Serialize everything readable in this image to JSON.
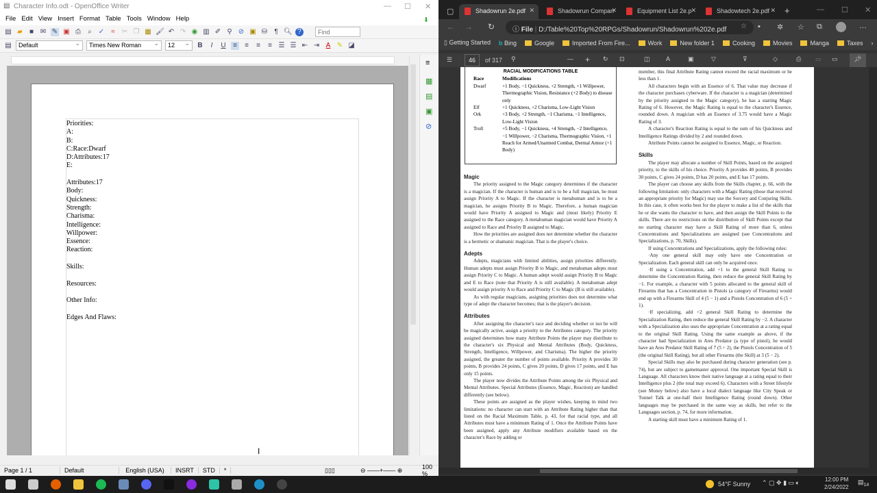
{
  "writer": {
    "title": "Character Info.odt - OpenOffice Writer",
    "menu": [
      "File",
      "Edit",
      "View",
      "Insert",
      "Format",
      "Table",
      "Tools",
      "Window",
      "Help"
    ],
    "find_placeholder": "Find",
    "paragraph_style": "Default",
    "font_name": "Times New Roman",
    "font_size": "12",
    "document_lines": [
      "Priorities:",
      "A:",
      "B:",
      "C:Race:Dwarf",
      "D:Attributes:17",
      "E:",
      "",
      "Attributes:17",
      "Body:",
      "Quickness:",
      "Strength:",
      "Charisma:",
      "Intelligence:",
      "Willpower:",
      "Essence:",
      "Reaction:",
      "",
      "Skills:",
      "",
      "Resources:",
      "",
      "Other Info:",
      "",
      "Edges And Flaws:"
    ],
    "status": {
      "page": "Page 1 / 1",
      "style": "Default",
      "language": "English (USA)",
      "insert_mode": "INSRT",
      "selection_mode": "STD",
      "modified": "*",
      "zoom": "100 %"
    }
  },
  "browser": {
    "tabs": [
      {
        "label": "Shadowrun 2e.pdf",
        "active": true
      },
      {
        "label": "Shadowrun Compan",
        "active": false
      },
      {
        "label": "Equipment List 2e.p",
        "active": false
      },
      {
        "label": "Shadowtech 2e.pdf",
        "active": false
      }
    ],
    "address_prefix": "File",
    "address": "D:/Table%20Top%20RPGs/Shadowrun/Shadowrun%202e.pdf",
    "bookmarks": [
      {
        "label": "Getting Started",
        "icon": "page-icon"
      },
      {
        "label": "Bing",
        "icon": "bing-icon"
      },
      {
        "label": "Google",
        "icon": "folder-icon"
      },
      {
        "label": "Imported From Fire...",
        "icon": "folder-icon"
      },
      {
        "label": "Work",
        "icon": "folder-icon"
      },
      {
        "label": "New folder 1",
        "icon": "folder-icon"
      },
      {
        "label": "Cooking",
        "icon": "folder-icon"
      },
      {
        "label": "Movies",
        "icon": "folder-icon"
      },
      {
        "label": "Manga",
        "icon": "folder-icon"
      },
      {
        "label": "Taxes",
        "icon": "folder-icon"
      }
    ],
    "pdf": {
      "page": "46",
      "of_pages": "of 317"
    }
  },
  "pdf_content": {
    "table": {
      "title": "RACIAL MODIFICATIONS TABLE",
      "headers": [
        "Race",
        "Modifications"
      ],
      "rows": [
        [
          "Dwarf",
          "+1 Body, −1 Quickness, +2 Strength, +1 Willpower, Thermographic Vision, Resistance (+2 Body) to disease only"
        ],
        [
          "Elf",
          "+1 Quickness, +2 Charisma, Low-Light Vision"
        ],
        [
          "Ork",
          "+3 Body, +2 Strength, −1 Charisma, −1 Intelligence, Low-Light Vision"
        ],
        [
          "Troll",
          "+5 Body, −1 Quickness, +4 Strength, −2 Intelligence, −1 Willpower, −2 Charisma, Thermographic Vision, +1 Reach for Armed/Unarmed Combat, Dermal Armor (+1 Body)"
        ]
      ]
    },
    "left": [
      {
        "h": "Magic"
      },
      {
        "p": "The priority assigned to the Magic category determines if the character is a magician. If the character is human and is to be a full magician, he must assign Priority A to Magic. If the character is metahuman and is to be a magician, he assigns Priority B to Magic. Therefore, a human magician would have Priority A assigned to Magic and (most likely) Priority E assigned to the Race category. A metahuman magician would have Priority A assigned to Race and Priority B assigned to Magic."
      },
      {
        "p": "How the priorities are assigned does not determine whether the character is a hermetic or shamanic magician. That is the player's choice."
      },
      {
        "h": "Adepts"
      },
      {
        "p": "Adepts, magicians with limited abilities, assign priorities differently. Human adepts must assign Priority B to Magic, and metahuman adepts must assign Priority C to Magic. A human adept would assign Priority B to Magic and E to Race (note that Priority A is still available). A metahuman adept would assign priority A to Race and Priority C to Magic (B is still available)."
      },
      {
        "p": "As with regular magicians, assigning priorities does not determine what type of adept the character becomes; that is the player's decision."
      },
      {
        "h": "Attributes"
      },
      {
        "p": "After assigning the character's race and deciding whether or not he will be magically active, assign a priority to the Attributes category. The priority assigned determines how many Attribute Points the player may distribute to the character's six Physical and Mental Attributes (Body, Quickness, Strength, Intelligence, Willpower, and Charisma). The higher the priority assigned, the greater the number of points available. Priority A provides 30 points, B provides 24 points, C gives 20 points, D gives 17 points, and E has only 15 points."
      },
      {
        "p": "The player now divides the Attribute Points among the six Physical and Mental Attributes. Special Attributes (Essence, Magic, Reaction) are handled differently (see below)."
      },
      {
        "p": "These points are assigned as the player wishes, keeping in mind two limitations: no character can start with an Attribute Rating higher than that listed on the Racial Maximum Table, p. 43, for that racial type, and all Attributes must have a minimum Rating of 1. Once the Attribute Points have been assigned, apply any Attribute modifiers available based on the character's Race by adding or"
      }
    ],
    "right": [
      {
        "p0": "member, this final Attribute Rating cannot exceed the racial maximum or be less than 1."
      },
      {
        "p": "All characters begin with an Essence of 6. That value may decrease if the character purchases cyberware. If the character is a magician (determined by the priority assigned to the Magic category), he has a starting Magic Rating of 6. However, the Magic Rating is equal to the character's Essence, rounded down. A magician with an Essence of 3.75 would have a Magic Rating of 3."
      },
      {
        "p": "A character's Reaction Rating is equal to the sum of his Quickness and Intelligence Ratings divided by 2 and rounded down."
      },
      {
        "p": "Attribute Points cannot be assigned to Essence, Magic, or Reaction."
      },
      {
        "h": "Skills"
      },
      {
        "p": "The player may allocate a number of Skill Points, based on the assigned priority, to the skills of his choice. Priority A provides 40 points, B provides 30 points, C gives 24 points, D has 20 points, and E has 17 points."
      },
      {
        "p": "The player can choose any skills from the Skills chapter, p. 66, with the following limitation: only characters with a Magic Rating (those that received an appropriate priority for Magic) may use the Sorcery and Conjuring Skills. In this case, it often works best for the player to make a list of the skills that he or she wants the character to have, and then assign the Skill Points to the skills. There are no restrictions on the distribution of Skill Points except that no starting character may have a Skill Rating of more than 6, unless Concentrations and Specializations are assigned (see Concentrations and Specializations, p. 70, Skills)."
      },
      {
        "p": "If using Concentrations and Specializations, apply the following rules:"
      },
      {
        "p": "·Any one general skill may only have one Concentration or Specialization. Each general skill can only be acquired once."
      },
      {
        "p": "·If using a Concentration, add +1 to the general Skill Rating to determine the Concentration Rating, then reduce the general Skill Rating by −1. For example, a character with 5 points allocated to the general skill of Firearms that has a Concentration in Pistols (a category of Firearms) would end up with a Firearms Skill of 4 (5 − 1) and a Pistols Concentration of 6 (5 + 1)."
      },
      {
        "p": "·If specializing, add +2 general Skill Rating to determine the Specialization Rating, then reduce the general Skill Rating by −2. A character with a Specialization also uses the appropriate Concentration at a rating equal to the original Skill Rating. Using the same example as above, if the character had Specialization in Ares Predator (a type of pistol), he would have an Ares Predator Skill Rating of 7 (5 + 2), the Pistols Concentration of 5 (the original Skill Rating), but all other Firearms (the Skill) at 3 (5 − 2)."
      },
      {
        "p": "Special Skills may also be purchased during character generation (see p. 74), but are subject to gamemaster approval. One important Special Skill is Language. All characters know their native language at a rating equal to their Intelligence plus 2 (the total may exceed 6). Characters with a Street lifestyle (see Money below) also have a local dialect language like City Speak or Tunnel Talk at one-half their Intelligence Rating (round down). Other languages may be purchased in the same way as skills, but refer to the Languages section, p. 74, for more information."
      },
      {
        "p": "A starting skill must have a minimum Rating of 1."
      }
    ]
  },
  "taskbar": {
    "weather": "54°F  Sunny",
    "time": "12:00 PM",
    "date": "2/24/2022",
    "notifications": "14",
    "apps": [
      "start",
      "task-view",
      "firefox",
      "file-explorer",
      "spotify",
      "calculator",
      "discord",
      "app",
      "obs-purple",
      "app-green",
      "openoffice-writer",
      "edge",
      "obs"
    ]
  }
}
